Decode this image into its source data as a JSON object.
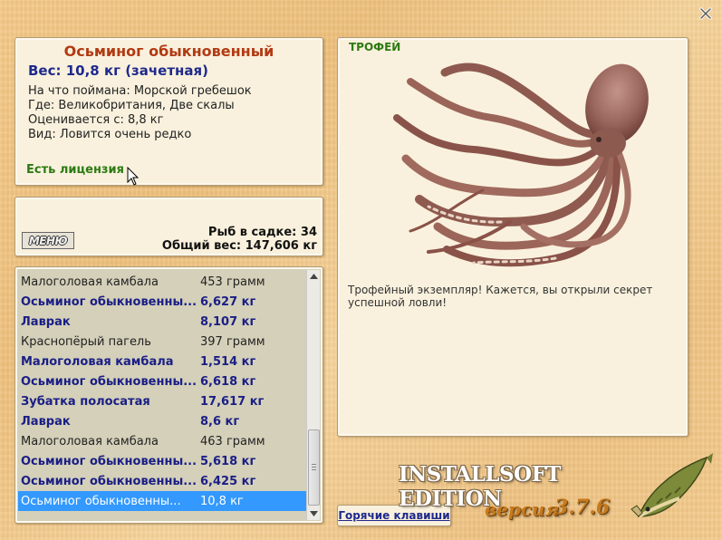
{
  "info": {
    "title": "Осьминог обыкновенный",
    "weight": "Вес: 10,8 кг (зачетная)",
    "caught_on": "На что поймана: Морской гребешок",
    "location": "Где: Великобритания, Две скалы",
    "valued_from": "Оценивается с: 8,8 кг",
    "kind": "Вид: Ловится очень редко",
    "license": "Есть лицензия"
  },
  "stats": {
    "menu_label": "МЕНЮ",
    "fish_count": "Рыб в садке: 34",
    "total_weight": "Общий вес: 147,606 кг"
  },
  "catch_list": [
    {
      "name": "Малоголовая камбала",
      "weight": "453 грамм",
      "style": "normal"
    },
    {
      "name": "Осьминог обыкновенны...",
      "weight": "6,627 кг",
      "style": "bold"
    },
    {
      "name": "Лаврак",
      "weight": "8,107 кг",
      "style": "bold"
    },
    {
      "name": "Краснопёрый пагель",
      "weight": "397 грамм",
      "style": "normal"
    },
    {
      "name": "Малоголовая камбала",
      "weight": "1,514 кг",
      "style": "bold"
    },
    {
      "name": "Осьминог обыкновенны...",
      "weight": "6,618 кг",
      "style": "bold"
    },
    {
      "name": "Зубатка полосатая",
      "weight": "17,617 кг",
      "style": "bold"
    },
    {
      "name": "Лаврак",
      "weight": "8,6 кг",
      "style": "bold"
    },
    {
      "name": "Малоголовая камбала",
      "weight": "463 грамм",
      "style": "normal"
    },
    {
      "name": "Осьминог обыкновенны...",
      "weight": "5,618 кг",
      "style": "bold"
    },
    {
      "name": "Осьминог обыкновенны...",
      "weight": "6,425 кг",
      "style": "bold"
    },
    {
      "name": "Осьминог обыкновенны...",
      "weight": "10,8 кг",
      "style": "selected"
    }
  ],
  "trophy": {
    "label": "ТРОФЕЙ",
    "text": "Трофейный экземпляр! Кажется, вы открыли секрет успешной ловли!"
  },
  "footer": {
    "hotkeys": "Горячие клавиши",
    "edition": "INSTALLSOFT EDITION",
    "version_prefix": "версия",
    "version": "3.7.6"
  },
  "colors": {
    "title": "#b23a13",
    "accent_blue": "#1f2a8c",
    "license_green": "#2d7a12",
    "selection": "#3399ff"
  }
}
